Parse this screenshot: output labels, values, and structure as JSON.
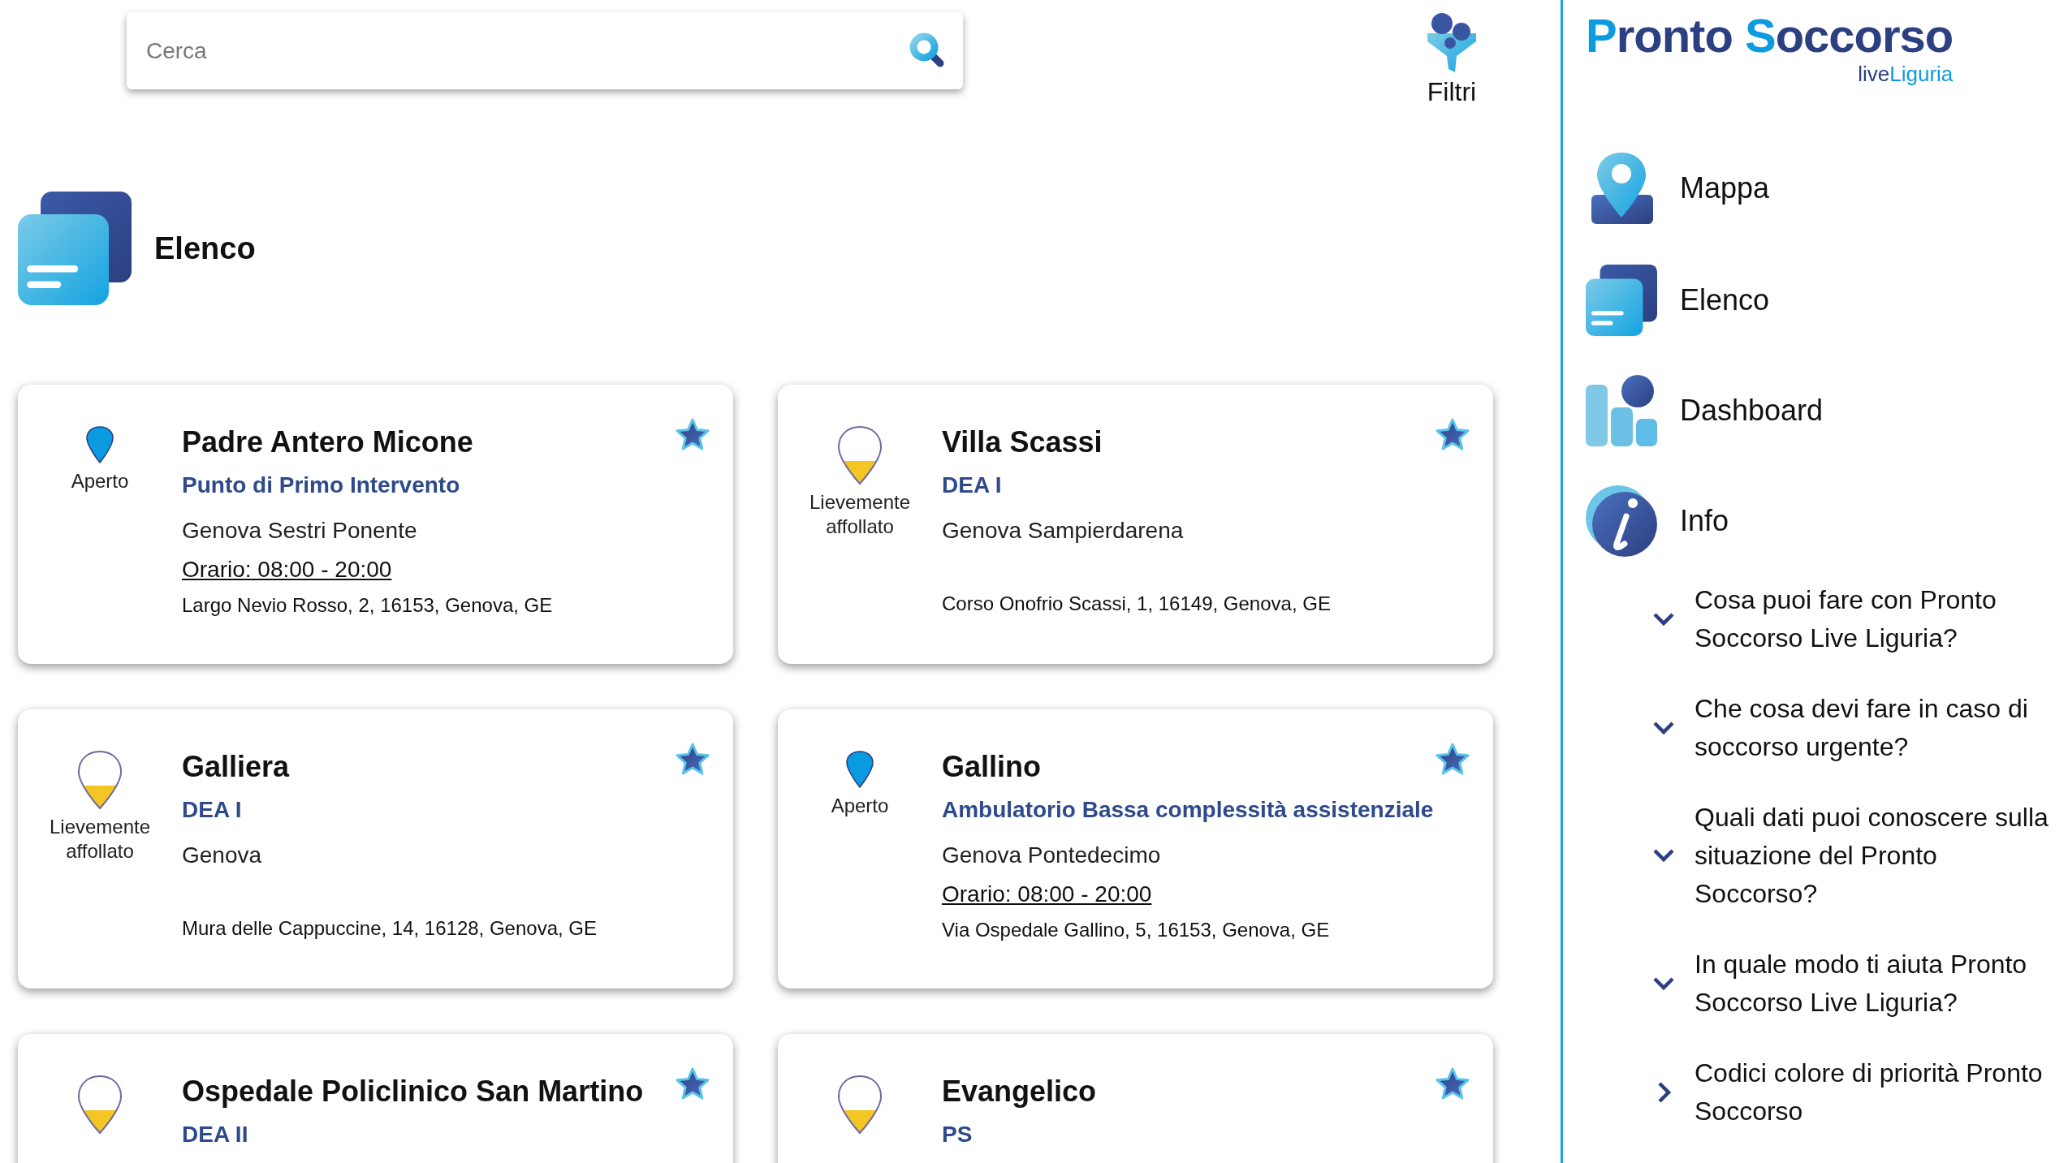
{
  "search": {
    "placeholder": "Cerca"
  },
  "filter_button": {
    "label": "Filtri"
  },
  "heading": {
    "title": "Elenco"
  },
  "cards": [
    {
      "name": "Padre Antero Micone",
      "type": "Punto di Primo Intervento",
      "kind": "open",
      "status_label": "Aperto",
      "location": "Genova Sestri Ponente",
      "hours": "Orario: 08:00 - 20:00",
      "address": "Largo Nevio Rosso, 2, 16153, Genova, GE"
    },
    {
      "name": "Villa Scassi",
      "type": "DEA I",
      "kind": "busy",
      "status_label": "Lievemente affollato",
      "location": "Genova Sampierdarena",
      "address": "Corso Onofrio Scassi, 1, 16149, Genova, GE"
    },
    {
      "name": "Galliera",
      "type": "DEA I",
      "kind": "busy",
      "status_label": "Lievemente affollato",
      "location": "Genova",
      "address": "Mura delle Cappuccine, 14, 16128, Genova, GE"
    },
    {
      "name": "Gallino",
      "type": "Ambulatorio Bassa complessità assistenziale",
      "kind": "open",
      "status_label": "Aperto",
      "location": "Genova Pontedecimo",
      "hours": "Orario: 08:00 - 20:00",
      "address": "Via Ospedale Gallino, 5, 16153, Genova, GE"
    },
    {
      "name": "Ospedale Policlinico San Martino",
      "type": "DEA II",
      "kind": "busy"
    },
    {
      "name": "Evangelico",
      "type": "PS",
      "kind": "busy"
    }
  ],
  "sidebar": {
    "logo": {
      "word1": "Pronto",
      "word2": "Soccorso",
      "sub1": "live",
      "sub2": "Liguria"
    },
    "items": [
      {
        "label": "Mappa",
        "kind": "map"
      },
      {
        "label": "Elenco",
        "kind": "list"
      },
      {
        "label": "Dashboard",
        "kind": "dashboard"
      },
      {
        "label": "Info",
        "kind": "info"
      }
    ],
    "faq": [
      {
        "text": "Cosa puoi fare con Pronto Soccorso Live Liguria?",
        "kind": "accordion"
      },
      {
        "text": "Che cosa devi fare in caso di soccorso urgente?",
        "kind": "accordion"
      },
      {
        "text": "Quali dati puoi conoscere sulla situazione del Pronto Soccorso?",
        "kind": "accordion"
      },
      {
        "text": "In quale modo ti aiuta Pronto Soccorso Live Liguria?",
        "kind": "accordion"
      },
      {
        "text": "Codici colore di priorità Pronto Soccorso",
        "kind": "link"
      }
    ]
  }
}
